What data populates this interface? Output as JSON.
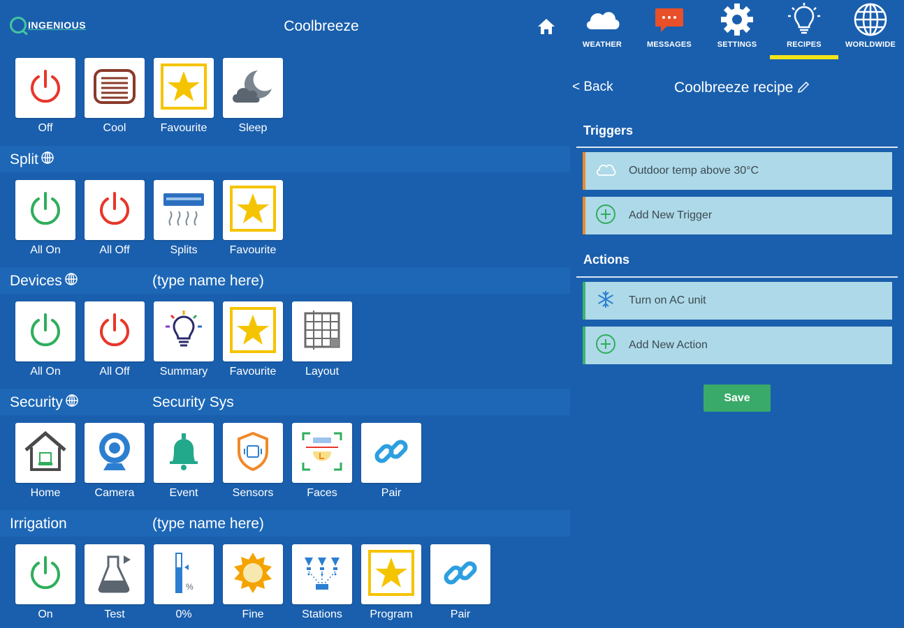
{
  "header": {
    "logo_text": "INGENIOUS",
    "title": "Coolbreeze",
    "home_icon": "home-icon"
  },
  "topnav": [
    {
      "label": "WEATHER",
      "icon": "cloud-icon"
    },
    {
      "label": "MESSAGES",
      "icon": "message-icon"
    },
    {
      "label": "SETTINGS",
      "icon": "gear-icon"
    },
    {
      "label": "RECIPES",
      "icon": "lightbulb-icon",
      "active": true
    },
    {
      "label": "WORLDWIDE",
      "icon": "globe-icon"
    }
  ],
  "sections": [
    {
      "name": "",
      "subtitle": "",
      "tiles": [
        {
          "label": "Off",
          "icon": "power-red-icon"
        },
        {
          "label": "Cool",
          "icon": "heater-icon"
        },
        {
          "label": "Favourite",
          "icon": "star-icon"
        },
        {
          "label": "Sleep",
          "icon": "moon-cloud-icon"
        }
      ]
    },
    {
      "name": "Split",
      "subtitle": "",
      "tiles": [
        {
          "label": "All On",
          "icon": "power-green-icon"
        },
        {
          "label": "All Off",
          "icon": "power-red-icon"
        },
        {
          "label": "Splits",
          "icon": "aircon-icon"
        },
        {
          "label": "Favourite",
          "icon": "star-icon"
        }
      ]
    },
    {
      "name": "Devices",
      "subtitle": "(type name here)",
      "tiles": [
        {
          "label": "All On",
          "icon": "power-green-icon"
        },
        {
          "label": "All Off",
          "icon": "power-red-icon"
        },
        {
          "label": "Summary",
          "icon": "bulb-color-icon"
        },
        {
          "label": "Favourite",
          "icon": "star-icon"
        },
        {
          "label": "Layout",
          "icon": "grid-icon"
        }
      ]
    },
    {
      "name": "Security",
      "subtitle": "Security Sys",
      "tiles": [
        {
          "label": "Home",
          "icon": "house-icon"
        },
        {
          "label": "Camera",
          "icon": "webcam-icon"
        },
        {
          "label": "Event",
          "icon": "bell-icon"
        },
        {
          "label": "Sensors",
          "icon": "shield-icon"
        },
        {
          "label": "Faces",
          "icon": "face-scan-icon"
        },
        {
          "label": "Pair",
          "icon": "link-icon"
        }
      ]
    },
    {
      "name": "Irrigation",
      "subtitle": "(type name here)",
      "tiles": [
        {
          "label": "On",
          "icon": "power-green-icon"
        },
        {
          "label": "Test",
          "icon": "flask-icon"
        },
        {
          "label": "0%",
          "icon": "gauge-icon"
        },
        {
          "label": "Fine",
          "icon": "sun-icon"
        },
        {
          "label": "Stations",
          "icon": "sprinkler-icon"
        },
        {
          "label": "Program",
          "icon": "star-icon"
        },
        {
          "label": "Pair",
          "icon": "link-icon"
        }
      ]
    }
  ],
  "recipe": {
    "back_label": "< Back",
    "title": "Coolbreeze recipe",
    "edit_icon": "pencil-icon",
    "triggers_heading": "Triggers",
    "triggers": [
      {
        "text": "Outdoor temp above 30°C",
        "icon": "cloud-outline-icon"
      },
      {
        "text": "Add New Trigger",
        "icon": "plus-circle-icon"
      }
    ],
    "actions_heading": "Actions",
    "actions": [
      {
        "text": "Turn on AC unit",
        "icon": "snowflake-icon"
      },
      {
        "text": "Add New Action",
        "icon": "plus-circle-icon"
      }
    ],
    "save_label": "Save"
  },
  "colors": {
    "background": "#1a5fad",
    "section_bar": "#1d67b6",
    "active_underline": "#f2e61a",
    "trigger_accent": "#f0892a",
    "action_accent": "#3fb36c",
    "save": "#3aaa6a",
    "card": "#aed9e8"
  }
}
